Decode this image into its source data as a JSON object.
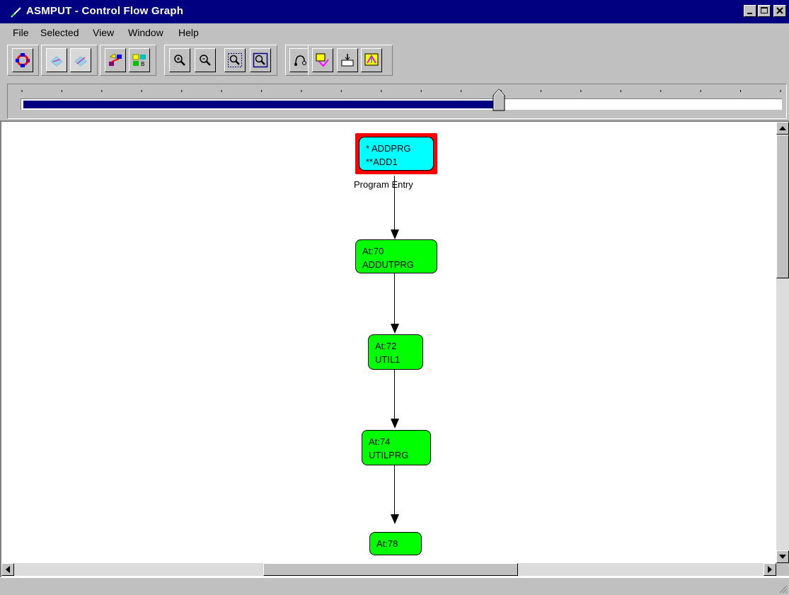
{
  "window": {
    "title": "ASMPUT - Control Flow Graph",
    "title_bar_color": "#000080"
  },
  "menu": [
    {
      "label": "File"
    },
    {
      "label": "Selected"
    },
    {
      "label": "View"
    },
    {
      "label": "Window"
    },
    {
      "label": "Help"
    }
  ],
  "toolbar": {
    "buttons": [
      {
        "icon": "graph-layout-icon"
      },
      {
        "icon": "collapse-icon"
      },
      {
        "icon": "expand-icon"
      },
      {
        "icon": "select-path-icon"
      },
      {
        "icon": "legend-icon"
      },
      {
        "icon": "zoom-in-icon"
      },
      {
        "icon": "zoom-out-icon"
      },
      {
        "icon": "zoom-fit-icon"
      },
      {
        "icon": "zoom-window-icon"
      },
      {
        "icon": "route-icon"
      },
      {
        "icon": "node-properties-icon"
      },
      {
        "icon": "insert-node-icon"
      },
      {
        "icon": "overview-icon"
      }
    ]
  },
  "slider": {
    "fill_fraction": 0.63,
    "fill_color": "#000080"
  },
  "graph": {
    "nodes": [
      {
        "id": "entry",
        "line1": "* ADDPRG",
        "line2": "**ADD1",
        "fill": "#00ffff",
        "highlight": "#ff0000",
        "caption": "Program Entry"
      },
      {
        "id": "n70",
        "line1": "At:70",
        "line2": "ADDUTPRG",
        "fill": "#00ff00"
      },
      {
        "id": "n72",
        "line1": "At:72",
        "line2": "UTIL1",
        "fill": "#00ff00"
      },
      {
        "id": "n74",
        "line1": "At:74",
        "line2": "UTILPRG",
        "fill": "#00ff00"
      },
      {
        "id": "n78",
        "line1": "At:78",
        "line2": "",
        "fill": "#00ff00"
      }
    ]
  },
  "status": {
    "text": ""
  }
}
